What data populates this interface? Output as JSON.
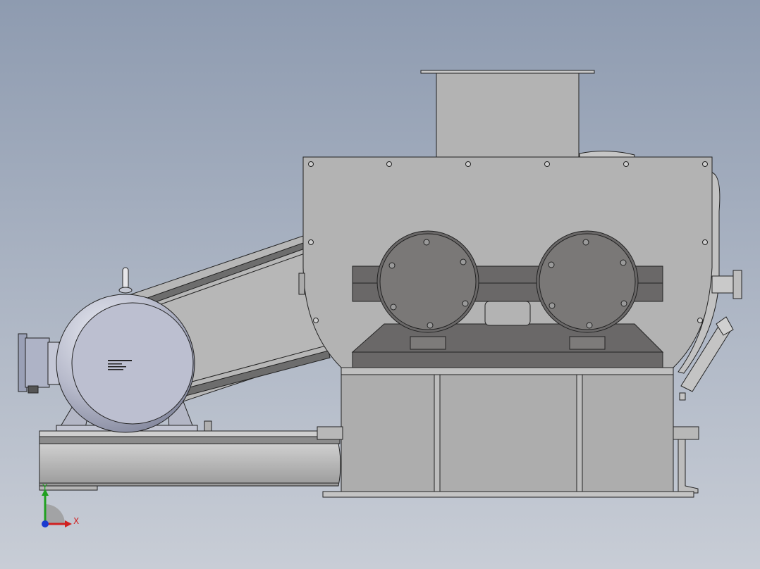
{
  "view": {
    "background_top": "#8e9bb0",
    "background_bottom": "#c8cdd6",
    "edge_color": "#222222"
  },
  "colors": {
    "housing": "#b2b2b2",
    "housing_dark": "#9a9a9a",
    "bearing": "#6a6868",
    "bearing_cap": "#7a7877",
    "motor": "#b9bccc",
    "motor_highlight": "#e3e5ee",
    "frame": "#adadad"
  },
  "triad": {
    "x_label": "X",
    "y_label": "Y",
    "x_color": "#d02020",
    "y_color": "#20a020",
    "z_color": "#1a3ad0"
  }
}
